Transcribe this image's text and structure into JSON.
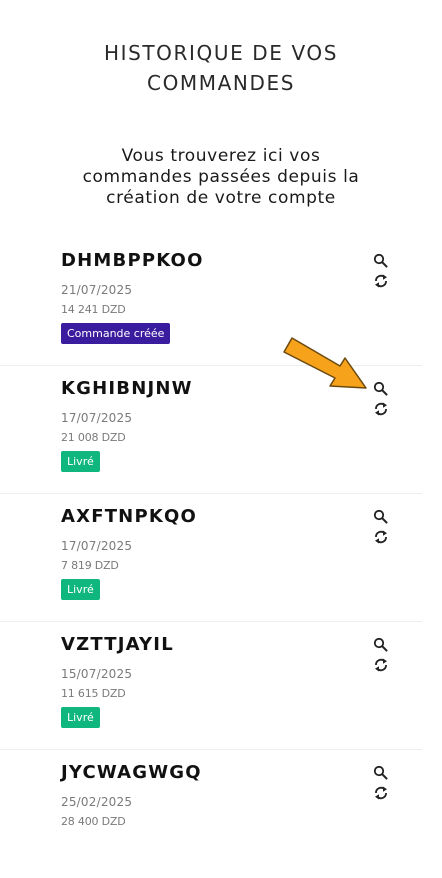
{
  "header": {
    "title_line1": "HISTORIQUE DE VOS",
    "title_line2": "COMMANDES",
    "subtitle_line1": "Vous trouverez ici vos",
    "subtitle_line2": "commandes passées depuis la",
    "subtitle_line3": "création de votre compte"
  },
  "orders": [
    {
      "ref": "DHMBPPKOO",
      "date": "21/07/2025",
      "amount": "14 241 DZD",
      "status": "Commande créée",
      "status_color": "#3a1c9e"
    },
    {
      "ref": "KGHIBNJNW",
      "date": "17/07/2025",
      "amount": "21 008 DZD",
      "status": "Livré",
      "status_color": "#0fb77f"
    },
    {
      "ref": "AXFTNPKQO",
      "date": "17/07/2025",
      "amount": "7 819 DZD",
      "status": "Livré",
      "status_color": "#0fb77f"
    },
    {
      "ref": "VZTTJAYIL",
      "date": "15/07/2025",
      "amount": "11 615 DZD",
      "status": "Livré",
      "status_color": "#0fb77f"
    },
    {
      "ref": "JYCWAGWGQ",
      "date": "25/02/2025",
      "amount": "28 400 DZD",
      "status": "",
      "status_color": "#0fb77f"
    }
  ],
  "icons": {
    "view": "search-icon",
    "reorder": "reorder-icon",
    "annotation": "arrow-annotation"
  },
  "colors": {
    "annotation_arrow": "#f7a21b",
    "annotation_outline": "#6b4a10"
  }
}
